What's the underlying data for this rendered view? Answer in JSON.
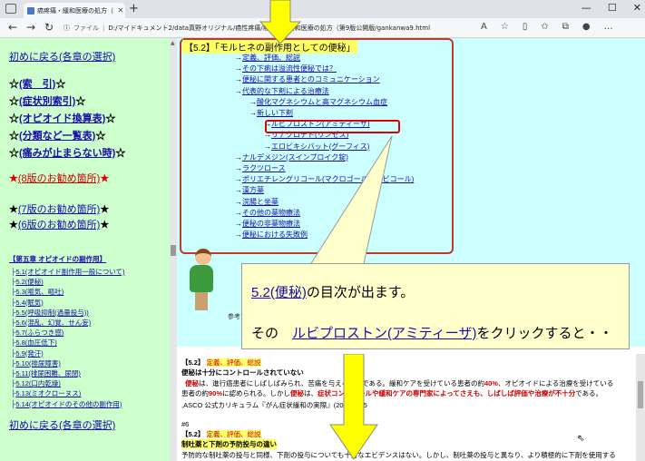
{
  "browser": {
    "tab_title": "癌疼痛・緩和医療の処方（第9版）",
    "url_prefix": "ファイル",
    "url": "D:/マイドキュメント2/data真野オリジナル/癌性疼痛/癌疼痛・緩和医療の処方（第9版公開版/gankanwa9.html",
    "icons": [
      "back-icon",
      "forward-icon",
      "reload-icon",
      "home-icon"
    ]
  },
  "left": {
    "back_link_top": "初めに戻る(各章の選択)",
    "items": [
      {
        "label": "(索　引)"
      },
      {
        "label": "(症状別索引)"
      },
      {
        "label": "(オピオイド換算表)"
      },
      {
        "label": "(分類など一覧表)"
      },
      {
        "label": "(痛みが止まらない時)"
      }
    ],
    "recommend8": "(8版のお勧め箇所)",
    "recommend7": "(7版のお勧め箇所)",
    "recommend6": "(6版のお勧め箇所)",
    "chapter_title": "【第五章 オピオイドの副作用】",
    "subs": [
      "5.1(オピオイド副作用一般について)",
      "5.2(便秘)",
      "5.3(嘔気、嘔吐)",
      "5.4(眠気)",
      "5.5(呼吸抑制(過量投与))",
      "5.6(混乱、幻覚、せん妄)",
      "5.7(ふらつき感)",
      "5.8(血圧低下)",
      "5.9(発汗)",
      "5.10(排尿障害)",
      "5.11(排尿困難、尿閉)",
      "5.12(口内乾燥)",
      "5.13(ミオクローヌス)",
      "5.14(オピオイドのその他の副作用)"
    ],
    "back_link_bottom": "初めに戻る(各章の選択)"
  },
  "toc": {
    "heading": "【5.2】「モルヒネの副作用としての便秘」",
    "items": [
      {
        "text": "定義、評価、総説",
        "indent": 0
      },
      {
        "text": "その下痢は溢流性便秘では？",
        "indent": 0
      },
      {
        "text": "便秘に関する患者とのコミュニケーション",
        "indent": 0
      },
      {
        "text": "代表的な下剤による治療法",
        "indent": 0
      },
      {
        "text": "酸化マグネシウムと高マグネシウム血症",
        "indent": 1
      },
      {
        "text": "新しい下剤",
        "indent": 1
      },
      {
        "text": "ルビプロストン(アミティーザ)",
        "indent": 2
      },
      {
        "text": "リナクロチド(リンゼス)",
        "indent": 2
      },
      {
        "text": "エロビキシバット(グーフィス)",
        "indent": 2
      },
      {
        "text": "ナルデメジン(スインプロイク錠)",
        "indent": 0
      },
      {
        "text": "ラクツロース",
        "indent": 0
      },
      {
        "text": "ポリエチレングリコール(マクロゴール、モビコール)",
        "indent": 0
      },
      {
        "text": "漢方薬",
        "indent": 0
      },
      {
        "text": "浣腸と坐薬",
        "indent": 0
      },
      {
        "text": "その他の薬物療法",
        "indent": 0
      },
      {
        "text": "便秘の非薬物療法",
        "indent": 0
      },
      {
        "text": "便秘における失敗例",
        "indent": 0
      }
    ],
    "person_caption": "参考"
  },
  "callout": {
    "line1_link": "5.2(便秘)",
    "line1_rest": "の目次が出ます。",
    "line2_pre": "その　",
    "line2_link": "ルビプロストン(アミティーザ)",
    "line2_rest": "をクリックすると・・"
  },
  "content": {
    "sec1_num": "【5.2】",
    "sec1_title": "定義、評価、総説",
    "sec1_bold": "便秘は十分にコントロールされていない",
    "sec1_p1a": "便秘",
    "sec1_p1b": "は、進行癌患者にしばしばみられ、苦痛を与える症状である。緩和ケアを受けている患者の約",
    "sec1_p1c": "40%",
    "sec1_p1d": "、オピオイドによる治療を受けている",
    "sec1_p2a": "患者の約",
    "sec1_p2b": "90%",
    "sec1_p2c": "に認められる。しかし",
    "sec1_p2d": "便秘",
    "sec1_p2e": "は、",
    "sec1_p2f": "症状コントロールや緩和ケアの専門家によってさえも、しばしば評価や治療が不十分",
    "sec1_p2g": "である。",
    "sec1_ref": ",ASCO 公式カリキュラム『がん症状緩和の実際』(2003) P15",
    "sec2_mark": "#6",
    "sec2_num": "【5.2】",
    "sec2_title": "定義、評価、総説",
    "sec2_bold": "制吐薬と下剤の予防投与の違い",
    "sec2_p1": "予防的な制吐薬の投与と同様、下剤の投与についても十分なエビデンスはない。しかし、制吐薬の投与と異なり、より積極的に下剤を使用する"
  }
}
